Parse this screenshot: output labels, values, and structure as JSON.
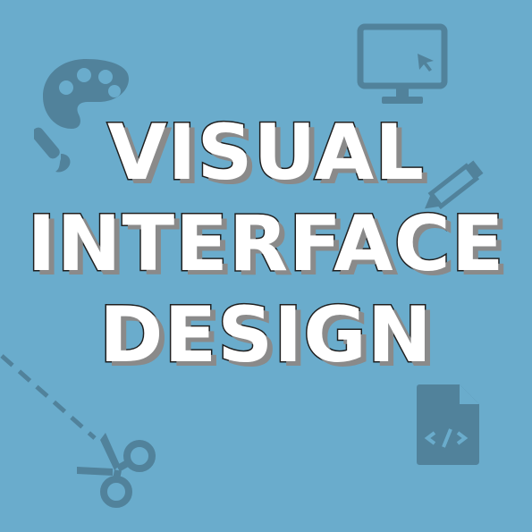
{
  "title": {
    "lines": [
      "VISUAL",
      "INTERFACE",
      "DESIGN"
    ]
  },
  "colors": {
    "background": "#6aaccc",
    "icon": "#4f7f97",
    "text_fill": "#ffffff",
    "text_outline": "#1f1f1f",
    "text_shadow": "#8a8a8a"
  },
  "icons": [
    "palette-icon",
    "paintbrush-icon",
    "monitor-icon",
    "cursor-icon",
    "pencil-icon",
    "scissors-icon",
    "dashed-cut-line",
    "code-file-icon"
  ]
}
